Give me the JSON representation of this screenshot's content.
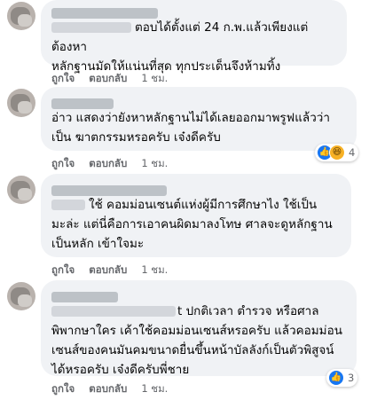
{
  "comments": [
    {
      "text_lines": [
        "ตอบได้ตั้งแต่ 24 ก.พ.แล้วเพียงแต่ต้องหา",
        "หลักฐานมัดให้แน่นที่สุด ทุกประเด็นจึงห้ามทิ้ง"
      ],
      "like_label": "ถูกใจ",
      "reply_label": "ตอบกลับ",
      "time": "1 ชม."
    },
    {
      "text_lines": [
        "อ่าว แสดงว่ายังหาหลักฐานไม่ได้เลยออกมาพรูฟแล้วว่า",
        "เป็น ฆาตกรรมหรอครับ เจ๋งดีครับ"
      ],
      "like_label": "ถูกใจ",
      "reply_label": "ตอบกลับ",
      "time": "1 ชม.",
      "reactions": {
        "icons": [
          "like-icon",
          "haha-icon"
        ],
        "count": "4"
      }
    },
    {
      "text_lines": [
        "ใช้ คอมม่อนเซนต์แห่งผู้มีการศึกษาไง ใช้เป็น",
        "มะล่ะ แต่นี่คือการเอาคนผิดมาลงโทษ ศาลจะดูหลักฐาน",
        "เป็นหลัก เข้าใจมะ"
      ],
      "like_label": "ถูกใจ",
      "reply_label": "ตอบกลับ",
      "time": "1 ชม."
    },
    {
      "text_lines": [
        "t ปกติเวลา ตำรวจ หรือศาล",
        "พิพากษาใคร เค้าใช้คอมม่อนเซนส์หรอครับ แล้วคอมม่อน",
        "เซนส์ของคนมันคมขนาดยื่นขึ้นหน้าบัลลังก์เป็นตัวพิสูจน์",
        "ได้หรอครับ เจ๋งดีครับพี่ชาย"
      ],
      "like_label": "ถูกใจ",
      "reply_label": "ตอบกลับ",
      "time": "1 ชม.",
      "reactions": {
        "icons": [
          "like-icon"
        ],
        "count": "3"
      }
    }
  ],
  "colors": {
    "bubble": "#f0f2f5",
    "meta": "#65676b",
    "like": "#1877f2",
    "haha": "#f7b125"
  }
}
